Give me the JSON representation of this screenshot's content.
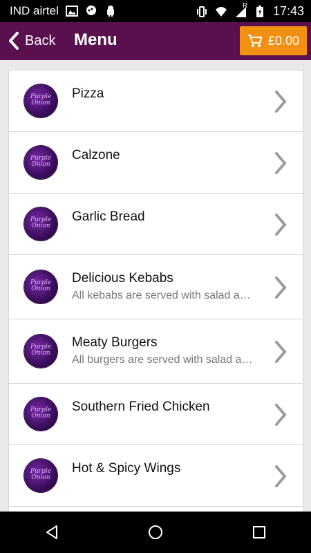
{
  "status_bar": {
    "carrier": "IND airtel",
    "time": "17:43",
    "network_label": "R"
  },
  "toolbar": {
    "back_label": "Back",
    "title": "Menu",
    "cart_amount": "£0.00"
  },
  "menu_items": [
    {
      "name": "Pizza",
      "description": ""
    },
    {
      "name": "Calzone",
      "description": ""
    },
    {
      "name": "Garlic Bread",
      "description": ""
    },
    {
      "name": "Delicious Kebabs",
      "description": "All kebabs are served with salad and sauce"
    },
    {
      "name": "Meaty Burgers",
      "description": "All burgers are served with salad and sauce"
    },
    {
      "name": "Southern Fried Chicken",
      "description": ""
    },
    {
      "name": "Hot & Spicy Wings",
      "description": ""
    }
  ],
  "logo_text": "Purple Onion",
  "colors": {
    "toolbar": "#5a0f4e",
    "cart_button": "#f39012",
    "status_bar": "#000000"
  }
}
